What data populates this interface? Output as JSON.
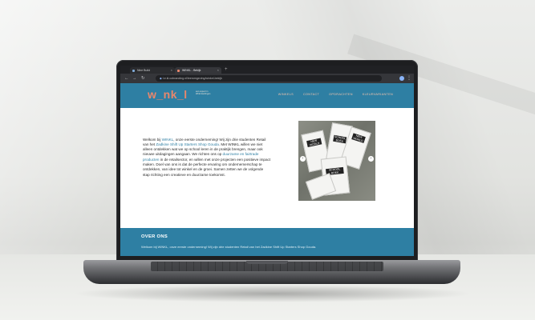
{
  "browser": {
    "tabs": [
      {
        "label": "Nine Build"
      },
      {
        "label": "WINKL - Bekijk"
      }
    ],
    "url": "t.e.kl.cobranding.nl/leeromgeving/winkel-bekijk"
  },
  "site": {
    "logo": "w_nk_l",
    "logo_tagline": "een expect in Winkl leerlingen",
    "nav": [
      "WINKELS",
      "CONTACT",
      "OPDRACHTEN",
      "KLEURVARIANTEN"
    ],
    "intro_parts": [
      {
        "text": "Welkom bij ",
        "highlight": false
      },
      {
        "text": "WINKL",
        "highlight": true
      },
      {
        "text": ", onze eerste onderneming! Wij zijn drie studenten Retail van het ",
        "highlight": false
      },
      {
        "text": "Zadkine Shift Up Starters Shop Gouda",
        "highlight": true
      },
      {
        "text": ". Met WINKL willen we niet alleen ontdekken wat we op school leren in de praktijk brengen, maar ook nieuwe uitdagingen aangaan. We richten ons op ",
        "highlight": false
      },
      {
        "text": "duurzame en fairtrade producten",
        "highlight": true
      },
      {
        "text": " in de retailsector, en willen met onze projecten een positieve impact maken. Doel van ons is dat de perfecte ervaring om ondernemerschap te ontdekken, van idee tot winkel en de groei. Samen zetten we de volgende stap richting een creatieve en duurzame toekomst.",
        "highlight": false
      }
    ],
    "products": [
      {
        "label": "NEW WORLD"
      },
      {
        "label": "SCHOOL BOEK"
      },
      {
        "label": "NEW WORLD"
      },
      {
        "label": "SCHOOL BOEK"
      }
    ],
    "about_title": "OVER ONS",
    "about_text": "Welkom bij WINKL, onze eerste onderneming! Wij zijn drie studenten Retail van het Zadkine Shift Up Starters Shop Gouda."
  },
  "colors": {
    "brand_blue": "#2e7fa3",
    "logo_orange": "#e9876c"
  }
}
